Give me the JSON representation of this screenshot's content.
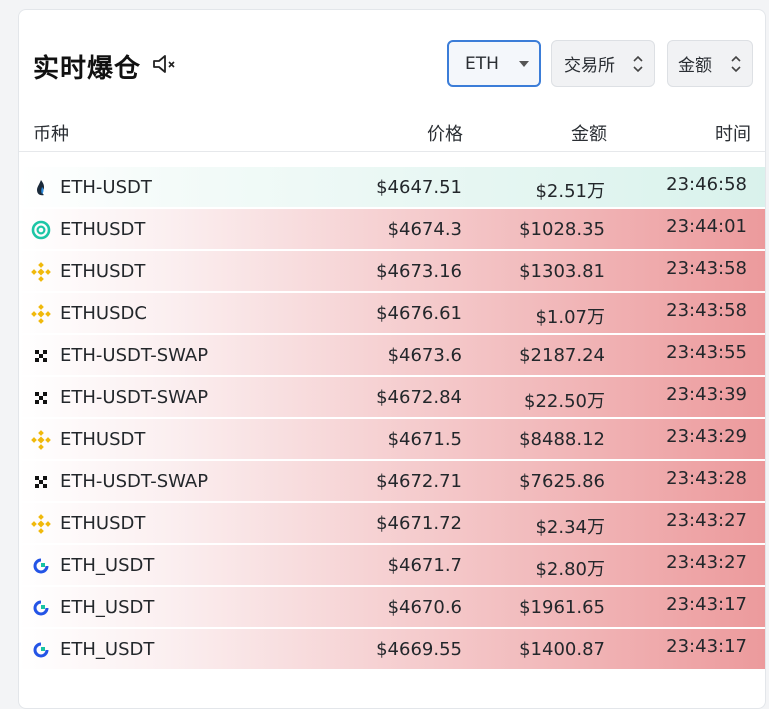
{
  "header": {
    "title": "实时爆仓",
    "coin_select": "ETH",
    "exchange_select": "交易所",
    "amount_select": "金额"
  },
  "columns": {
    "coin": "币种",
    "price": "价格",
    "amount": "金额",
    "time": "时间"
  },
  "colors": {
    "long_tint": "#d9f2ec",
    "short_tint": "#ec9a9c",
    "accent": "#3b7dd8"
  },
  "rows": [
    {
      "exchange_icon": "huobi-icon",
      "symbol": "ETH-USDT",
      "price": "$4647.51",
      "amount": "$2.51万",
      "time": "23:46:58",
      "side": "long"
    },
    {
      "exchange_icon": "coinex-icon",
      "symbol": "ETHUSDT",
      "price": "$4674.3",
      "amount": "$1028.35",
      "time": "23:44:01",
      "side": "short"
    },
    {
      "exchange_icon": "binance-icon",
      "symbol": "ETHUSDT",
      "price": "$4673.16",
      "amount": "$1303.81",
      "time": "23:43:58",
      "side": "short"
    },
    {
      "exchange_icon": "binance-icon",
      "symbol": "ETHUSDC",
      "price": "$4676.61",
      "amount": "$1.07万",
      "time": "23:43:58",
      "side": "short"
    },
    {
      "exchange_icon": "okx-icon",
      "symbol": "ETH-USDT-SWAP",
      "price": "$4673.6",
      "amount": "$2187.24",
      "time": "23:43:55",
      "side": "short"
    },
    {
      "exchange_icon": "okx-icon",
      "symbol": "ETH-USDT-SWAP",
      "price": "$4672.84",
      "amount": "$22.50万",
      "time": "23:43:39",
      "side": "short"
    },
    {
      "exchange_icon": "binance-icon",
      "symbol": "ETHUSDT",
      "price": "$4671.5",
      "amount": "$8488.12",
      "time": "23:43:29",
      "side": "short"
    },
    {
      "exchange_icon": "okx-icon",
      "symbol": "ETH-USDT-SWAP",
      "price": "$4672.71",
      "amount": "$7625.86",
      "time": "23:43:28",
      "side": "short"
    },
    {
      "exchange_icon": "binance-icon",
      "symbol": "ETHUSDT",
      "price": "$4671.72",
      "amount": "$2.34万",
      "time": "23:43:27",
      "side": "short"
    },
    {
      "exchange_icon": "gate-icon",
      "symbol": "ETH_USDT",
      "price": "$4671.7",
      "amount": "$2.80万",
      "time": "23:43:27",
      "side": "short"
    },
    {
      "exchange_icon": "gate-icon",
      "symbol": "ETH_USDT",
      "price": "$4670.6",
      "amount": "$1961.65",
      "time": "23:43:17",
      "side": "short"
    },
    {
      "exchange_icon": "gate-icon",
      "symbol": "ETH_USDT",
      "price": "$4669.55",
      "amount": "$1400.87",
      "time": "23:43:17",
      "side": "short"
    }
  ]
}
